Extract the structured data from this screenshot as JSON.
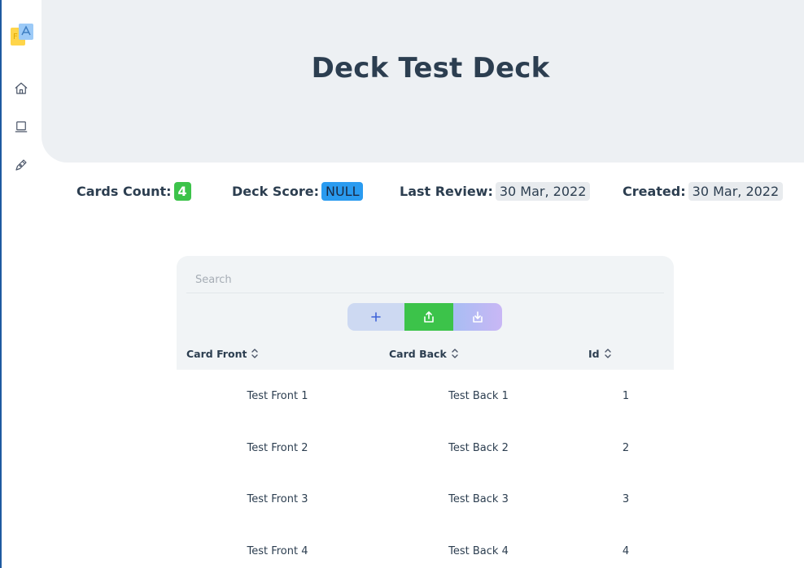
{
  "page": {
    "title": "Deck Test Deck"
  },
  "stats": {
    "cards_count_label": "Cards Count:",
    "cards_count_value": "4",
    "deck_score_label": "Deck Score:",
    "deck_score_value": "NULL",
    "last_review_label": "Last Review:",
    "last_review_value": "30 Mar, 2022",
    "created_label": "Created:",
    "created_value": "30 Mar, 2022"
  },
  "sidebar": {
    "items": [
      {
        "icon": "home-icon"
      },
      {
        "icon": "book-icon"
      },
      {
        "icon": "pen-icon"
      }
    ]
  },
  "table": {
    "search_placeholder": "Search",
    "search_value": "",
    "columns": [
      "Card Front",
      "Card Back",
      "Id"
    ],
    "rows": [
      {
        "front": "Test Front 1",
        "back": "Test Back 1",
        "id": "1"
      },
      {
        "front": "Test Front 2",
        "back": "Test Back 2",
        "id": "2"
      },
      {
        "front": "Test Front 3",
        "back": "Test Back 3",
        "id": "3"
      },
      {
        "front": "Test Front 4",
        "back": "Test Back 4",
        "id": "4"
      }
    ],
    "toolbar": {
      "add_icon": "plus-icon",
      "export_icon": "export-icon",
      "import_icon": "import-icon"
    }
  },
  "colors": {
    "accent_green": "#3cc34a",
    "accent_blue": "#2a9bf0",
    "header_bg": "#edf0f3",
    "text_dark": "#2c3e50"
  }
}
